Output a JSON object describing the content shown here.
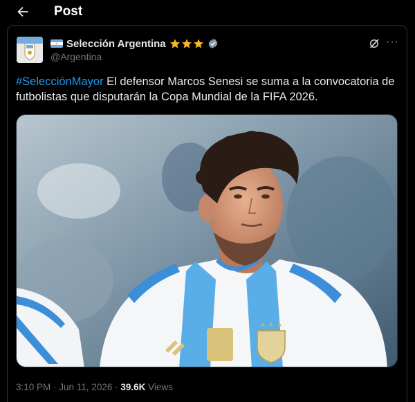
{
  "header": {
    "title": "Post",
    "back_icon": "arrow-left-icon"
  },
  "author": {
    "name": "Selección Argentina",
    "handle": "@Argentina",
    "flag_icon": "argentina-flag-icon",
    "badges": [
      "star-icon",
      "star-icon",
      "star-icon",
      "verified-badge-icon"
    ],
    "star_color": "#f7b928",
    "verified_color": "#829aab"
  },
  "actions": {
    "grok_icon": "grok-icon",
    "more_label": "···"
  },
  "post": {
    "hashtag": "#SelecciónMayor",
    "text": " El defensor Marcos Senesi se suma a la convocatoria de futbolistas que disputarán la Copa Mundial de la FIFA 2026.",
    "hashtag_color": "#1d9bf0"
  },
  "media": {
    "alt_icon": "photo-player-argentina-jersey"
  },
  "meta": {
    "time": "3:10 PM",
    "separator": " · ",
    "date": "Jun 11, 2026",
    "views_count": "39.6K",
    "views_label": "Views"
  }
}
